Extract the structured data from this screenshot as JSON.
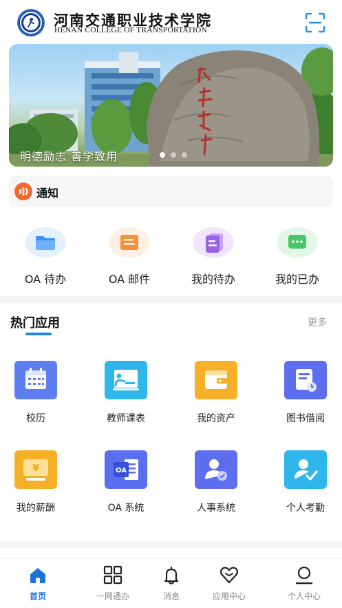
{
  "header": {
    "school_name_cn": "河南交通职业技术学院",
    "school_name_en": "HENAN COLLEGE OF TRANSPORTATION"
  },
  "banner": {
    "caption": "明德励志 善学致用",
    "active_index": 0,
    "count": 3
  },
  "notice": {
    "label": "通知"
  },
  "quick_actions": [
    {
      "label": "OA 待办",
      "icon": "folder-icon",
      "bg": "#e3f0ff",
      "fg": "#3d8ef0"
    },
    {
      "label": "OA 邮件",
      "icon": "mail-icon",
      "bg": "#fff0e3",
      "fg": "#f5913a"
    },
    {
      "label": "我的待办",
      "icon": "todo-icon",
      "bg": "#f1e6ff",
      "fg": "#9a62e8"
    },
    {
      "label": "我的已办",
      "icon": "chat-done-icon",
      "bg": "#e3f7e8",
      "fg": "#4cc46b"
    }
  ],
  "hot_apps": {
    "title": "热门应用",
    "more": "更多",
    "items": [
      {
        "label": "校历",
        "icon": "calendar-icon",
        "color": "#5d7ef0"
      },
      {
        "label": "教师课表",
        "icon": "teacher-board-icon",
        "color": "#2fb6ea"
      },
      {
        "label": "我的资产",
        "icon": "wallet-icon",
        "color": "#f5b028"
      },
      {
        "label": "图书借阅",
        "icon": "book-borrow-icon",
        "color": "#5d6ef0"
      },
      {
        "label": "我的薪酬",
        "icon": "salary-icon",
        "color": "#f5b028"
      },
      {
        "label": "OA 系统",
        "icon": "oa-system-icon",
        "color": "#5a6ef0"
      },
      {
        "label": "人事系统",
        "icon": "hr-system-icon",
        "color": "#5d6ef0"
      },
      {
        "label": "个人考勤",
        "icon": "attendance-icon",
        "color": "#2fb6ea"
      }
    ]
  },
  "tabbar": [
    {
      "label": "首页",
      "icon": "home-icon",
      "active": true
    },
    {
      "label": "一网通办",
      "icon": "grid-icon",
      "active": false
    },
    {
      "label": "消息",
      "icon": "bell-icon",
      "active": false
    },
    {
      "label": "应用中心",
      "icon": "heart-icon",
      "active": false
    },
    {
      "label": "个人中心",
      "icon": "person-icon",
      "active": false
    }
  ],
  "colors": {
    "accent": "#1e73d8",
    "notice": "#ef6a33"
  }
}
